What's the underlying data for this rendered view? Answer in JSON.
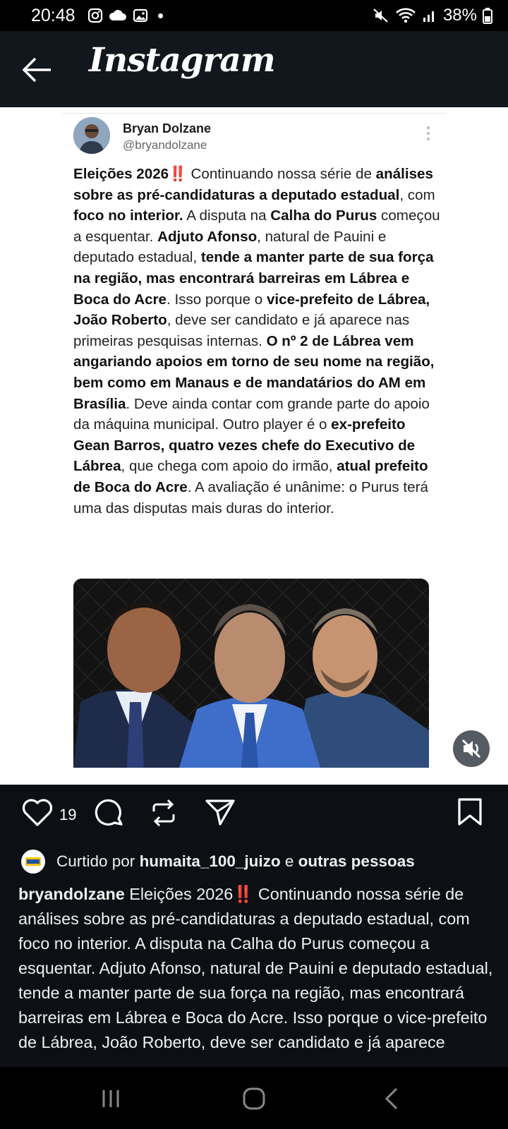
{
  "status": {
    "time": "20:48",
    "battery": "38%"
  },
  "header": {
    "app_title": "Instagram"
  },
  "tweet": {
    "name": "Bryan Dolzane",
    "handle": "@bryandolzane",
    "text": [
      {
        "t": "Eleições 2026",
        "b": true
      },
      {
        "t": "‼️",
        "b": false
      },
      {
        "t": " Continuando nossa série de ",
        "b": false
      },
      {
        "t": "análises sobre as pré-candidaturas a deputado estadual",
        "b": true
      },
      {
        "t": ", com ",
        "b": false
      },
      {
        "t": "foco no interior.",
        "b": true
      },
      {
        "t": " A disputa na ",
        "b": false
      },
      {
        "t": "Calha do Purus",
        "b": true
      },
      {
        "t": " começou a esquentar. ",
        "b": false
      },
      {
        "t": "Adjuto Afonso",
        "b": true
      },
      {
        "t": ", natural de Pauini e deputado estadual, ",
        "b": false
      },
      {
        "t": "tende a manter parte de sua força na região, mas encontrará barreiras em Lábrea e Boca do Acre",
        "b": true
      },
      {
        "t": ". Isso porque o ",
        "b": false
      },
      {
        "t": "vice-prefeito de Lábrea, João Roberto",
        "b": true
      },
      {
        "t": ", deve ser candidato e já aparece nas primeiras pesquisas internas. ",
        "b": false
      },
      {
        "t": "O nº 2 de Lábrea vem angariando apoios em torno de seu nome na região, bem como em Manaus e de mandatários do AM em Brasília",
        "b": true
      },
      {
        "t": ". Deve ainda contar com grande parte do apoio da máquina municipal. Outro player é o ",
        "b": false
      },
      {
        "t": "ex-prefeito Gean Barros, quatro vezes chefe do Executivo de Lábrea",
        "b": true
      },
      {
        "t": ", que chega com apoio do irmão, ",
        "b": false
      },
      {
        "t": "atual prefeito de Boca do Acre",
        "b": true
      },
      {
        "t": ". A avaliação é unânime: o Purus terá uma das disputas mais duras do interior.",
        "b": false
      }
    ]
  },
  "actions": {
    "likes": "19",
    "icons": [
      "heart-icon",
      "comment-icon",
      "repost-icon",
      "share-icon",
      "bookmark-icon"
    ]
  },
  "liked_by": {
    "prefix": "Curtido por ",
    "user": "humaita_100_juizo",
    "middle": " e ",
    "others": "outras pessoas"
  },
  "caption": {
    "username": "bryandolzane",
    "text": " Eleições 2026‼️ Continuando nossa série de análises sobre as pré-candidaturas a deputado estadual, com foco no interior. A disputa na Calha do Purus começou a esquentar. Adjuto Afonso, natural de Pauini e deputado estadual, tende a manter parte de sua força na região, mas encontrará barreiras em Lábrea e Boca do Acre. Isso porque o vice-prefeito de Lábrea, João Roberto, deve ser candidato e já aparece"
  },
  "colors": {
    "background": "#0c1014",
    "post_bg": "#ffffff",
    "text": "#f5f5f5"
  }
}
